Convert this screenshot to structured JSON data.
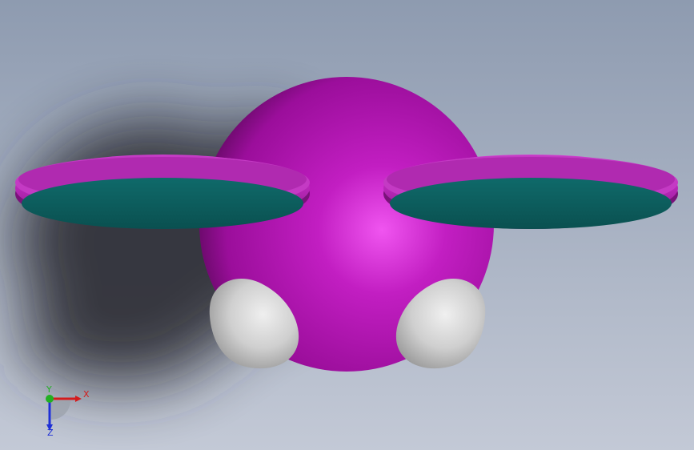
{
  "viewport": {
    "background_top": "#8e9bb0",
    "background_bottom": "#c3c9d6"
  },
  "model": {
    "sphere": {
      "color": "#c21ec2",
      "highlight": "#f055f0",
      "shade": "#6e0a6e"
    },
    "discs": {
      "rim_color": "#b829b8",
      "face_color": "#0d5e5e"
    },
    "bulbs": {
      "color": "#cfcfcf",
      "shade": "#8c8c8c"
    },
    "shadow": {
      "color": "#2a2c30"
    }
  },
  "triad": {
    "x_label": "X",
    "y_label": "Y",
    "z_label": "Z",
    "x_color": "#d41c1c",
    "y_color": "#22b022",
    "z_color": "#1e2fd6"
  }
}
